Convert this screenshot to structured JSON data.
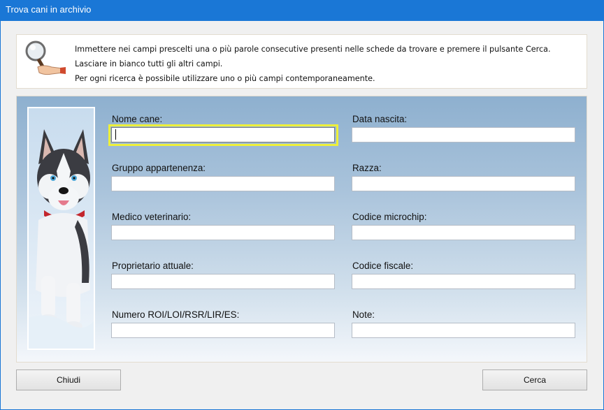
{
  "window": {
    "title": "Trova cani in archivio"
  },
  "info": {
    "line1": "Immettere nei campi prescelti una o più parole consecutive presenti nelle schede da trovare e premere il pulsante Cerca.",
    "line2": "Lasciare in bianco tutti gli altri campi.",
    "line3": "Per ogni ricerca è possibile utilizzare uno o più campi contemporaneamente."
  },
  "fields": {
    "nome_cane": {
      "label": "Nome cane:",
      "value": ""
    },
    "data_nascita": {
      "label": "Data nascita:",
      "value": ""
    },
    "gruppo": {
      "label": "Gruppo appartenenza:",
      "value": ""
    },
    "razza": {
      "label": "Razza:",
      "value": ""
    },
    "medico": {
      "label": "Medico veterinario:",
      "value": ""
    },
    "microchip": {
      "label": "Codice microchip:",
      "value": ""
    },
    "proprietario": {
      "label": "Proprietario attuale:",
      "value": ""
    },
    "codice_fiscale": {
      "label": "Codice fiscale:",
      "value": ""
    },
    "roi": {
      "label": "Numero ROI/LOI/RSR/LIR/ES:",
      "value": ""
    },
    "note": {
      "label": "Note:",
      "value": ""
    }
  },
  "buttons": {
    "close": "Chiudi",
    "search": "Cerca"
  },
  "icons": {
    "info": "magnifier-hand-icon"
  },
  "colors": {
    "titlebar": "#1a77d6",
    "focus": "#eef03a"
  }
}
